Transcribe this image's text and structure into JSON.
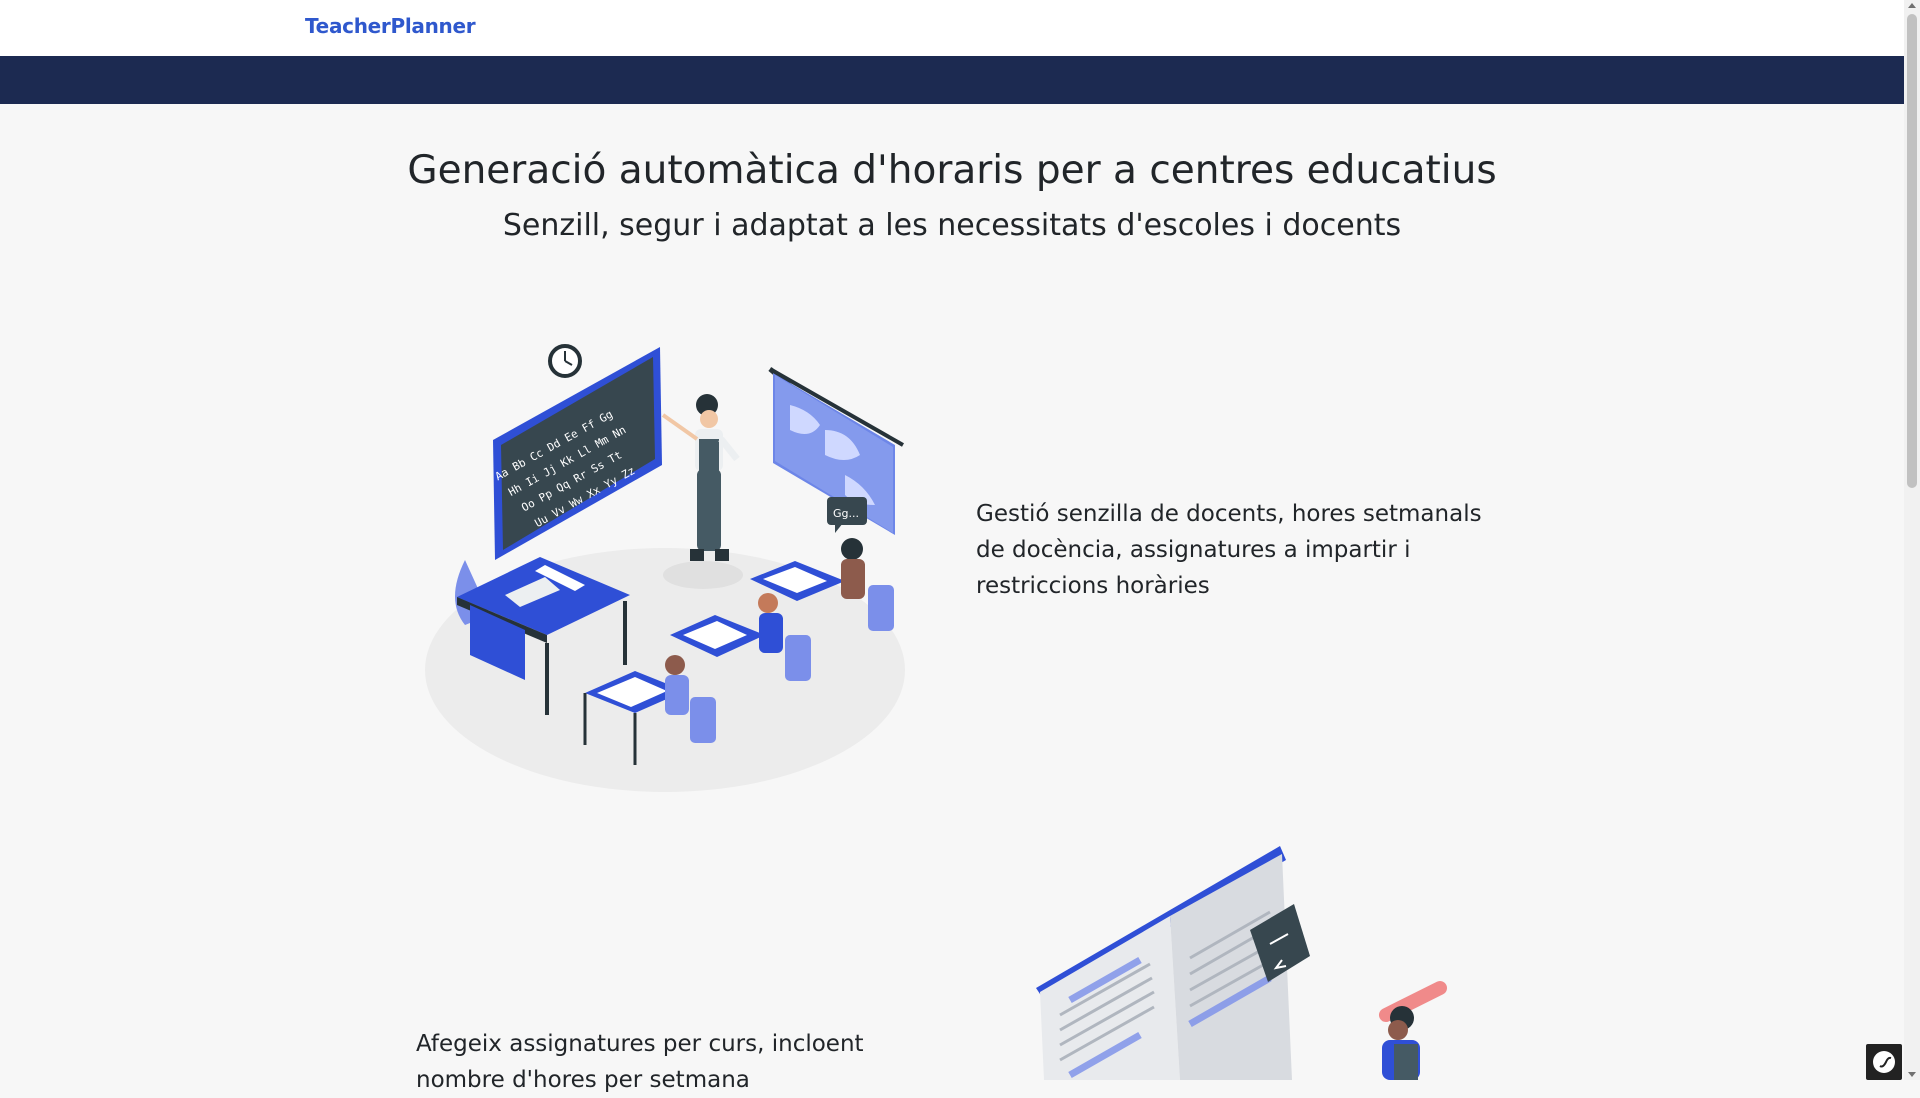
{
  "navbar": {
    "brand": "TeacherPlanner"
  },
  "hero": {
    "title": "Generació automàtica d'horaris per a centres educatius",
    "subtitle": "Senzill, segur i adaptat a les necessitats d'escoles i docents"
  },
  "features": [
    {
      "text": "Gestió senzilla de docents, hores setmanals de docència, assignatures a impartir i restriccions horàries"
    },
    {
      "text": "Afegeix assignatures per curs, incloent nombre d'hores per setmana"
    }
  ],
  "colors": {
    "brand": "#2f58cd",
    "nav_band": "#1c2a51",
    "accent_blue": "#2f4fd6",
    "page_bg": "#f7f7f7"
  },
  "icons": [
    "classroom-illustration",
    "chalkboard-letters",
    "clock-icon",
    "world-map",
    "book-illustration",
    "symfony-icon"
  ],
  "illustration_text": {
    "speech_bubble": "Gg...",
    "chalkboard_rows": [
      "Aa Bb Cc Dd Ee Ff Gg",
      "Hh Ii Jj Kk Ll Mm Nn",
      "Oo Pp Qq Rr Ss Tt",
      "Uu Vv Ww Xx Yy Zz"
    ]
  }
}
